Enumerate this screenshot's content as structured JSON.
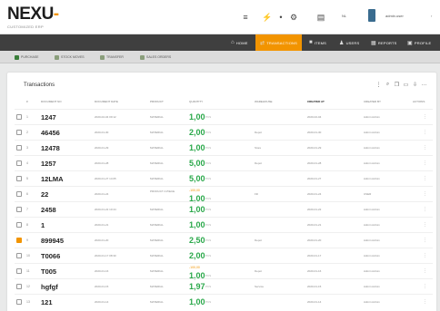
{
  "logo": {
    "main": "NEXU",
    "accent": "-",
    "sub": "CUSTOMIZED ERP"
  },
  "header": {
    "menu_icon": "hamburger-icon",
    "user_short": "ADMIN",
    "user_name": "admin.user",
    "user_suffix": "NL"
  },
  "nav": [
    {
      "label": "HOME",
      "icon": "home-icon"
    },
    {
      "label": "TRANSACTIONS",
      "icon": "transfer-icon"
    },
    {
      "label": "ITEMS",
      "icon": "box-icon"
    },
    {
      "label": "USERS",
      "icon": "users-icon"
    },
    {
      "label": "REPORTS",
      "icon": "report-icon"
    },
    {
      "label": "PROFILE",
      "icon": "profile-icon"
    }
  ],
  "subnav": [
    {
      "label": "PURCHASE"
    },
    {
      "label": "STOCK MOVES"
    },
    {
      "label": "TRANSFER"
    },
    {
      "label": "SALES ORDERS"
    }
  ],
  "panel": {
    "title": "Transactions"
  },
  "table": {
    "headers": [
      "#",
      "DOCUMENT NO",
      "DOCUMENT DATE",
      "PRODUCT",
      "QUANTITY",
      "WAREHOUSE",
      "CREATED AT",
      "CREATED BY",
      "ACTIONS"
    ],
    "rows": [
      {
        "idx": "1",
        "code": "1247",
        "date": "2020-02-04 09:12",
        "product": "MATERIAL",
        "qty": "1,00",
        "unit": "PCS",
        "warehouse": "",
        "created": "2020-02-04",
        "by": "Admin Admin",
        "checked": false
      },
      {
        "idx": "2",
        "code": "46456",
        "date": "2020-01-30",
        "product": "MATERIAL",
        "qty": "2,00",
        "unit": "PCS",
        "warehouse": "Depot",
        "created": "2020-01-30",
        "by": "Admin Admin",
        "checked": false
      },
      {
        "idx": "3",
        "code": "12478",
        "date": "2020-01-29",
        "product": "MATERIAL",
        "qty": "1,00",
        "unit": "PCS",
        "warehouse": "Store",
        "created": "2020-01-29",
        "by": "Admin Admin",
        "checked": false
      },
      {
        "idx": "4",
        "code": "1257",
        "date": "2020-01-28",
        "product": "MATERIAL",
        "qty": "5,00",
        "unit": "PCS",
        "warehouse": "Depot",
        "created": "2020-01-28",
        "by": "Admin Admin",
        "checked": false
      },
      {
        "idx": "5",
        "code": "12LMA",
        "date": "2020-01-27 14:05",
        "product": "MATERIAL",
        "qty": "5,00",
        "unit": "PCS",
        "warehouse": "",
        "created": "2020-01-27",
        "by": "Admin Admin",
        "checked": false
      },
      {
        "idx": "6",
        "code": "22",
        "date": "2020-01-24",
        "product": "PRODUCT A PIECE",
        "qty": "1,00",
        "unit": "PCS",
        "warning": "-100,00",
        "warehouse": "Fill",
        "created": "2020-01-24",
        "by": "USER",
        "checked": false
      },
      {
        "idx": "7",
        "code": "2458",
        "date": "2020-01-22 10:44",
        "product": "MATERIAL",
        "qty": "1,00",
        "unit": "PCS",
        "warehouse": "",
        "created": "2020-01-22",
        "by": "Admin Admin",
        "checked": false
      },
      {
        "idx": "8",
        "code": "1",
        "date": "2020-01-21",
        "product": "MATERIAL",
        "qty": "1,00",
        "unit": "PCS",
        "warehouse": "",
        "created": "2020-01-21",
        "by": "Admin Admin",
        "checked": false
      },
      {
        "idx": "9",
        "code": "899945",
        "date": "2020-01-20",
        "product": "MATERIAL",
        "qty": "2,50",
        "unit": "PCS",
        "warehouse": "Depot",
        "created": "2020-01-20",
        "by": "Admin Admin",
        "checked": true
      },
      {
        "idx": "10",
        "code": "T0066",
        "date": "2020-01-17 08:30",
        "product": "MATERIAL",
        "qty": "2,00",
        "unit": "PCS",
        "warehouse": "",
        "created": "2020-01-17",
        "by": "Admin Admin",
        "checked": false
      },
      {
        "idx": "11",
        "code": "T005",
        "date": "2020-01-16",
        "product": "MATERIAL",
        "qty": "1,00",
        "unit": "PCS",
        "warning": "-100,00",
        "warehouse": "Depot",
        "created": "2020-01-16",
        "by": "Admin Admin",
        "checked": false
      },
      {
        "idx": "12",
        "code": "hgfgf",
        "date": "2020-01-15",
        "product": "MATERIAL",
        "qty": "1,97",
        "unit": "PCS",
        "warehouse": "Service",
        "created": "2020-01-15",
        "by": "Admin Admin",
        "checked": false
      },
      {
        "idx": "13",
        "code": "121",
        "date": "2020-01-14",
        "product": "MATERIAL",
        "qty": "1,00",
        "unit": "PCS",
        "warehouse": "",
        "created": "2020-01-14",
        "by": "Admin Admin",
        "checked": false
      }
    ]
  },
  "colors": {
    "accent": "#f29400",
    "nav_bg": "#3f3f3f",
    "qty_green": "#2aa84a"
  }
}
